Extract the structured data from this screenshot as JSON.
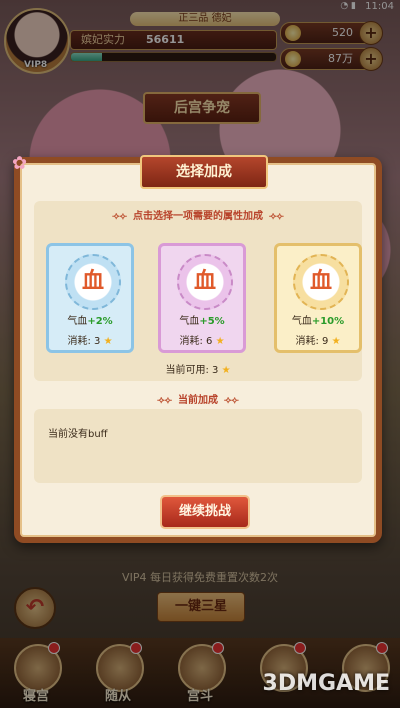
{
  "status_bar": {
    "time": "11:04",
    "signal": "WiFi"
  },
  "player": {
    "vip_label": "VIP8",
    "rank_text": "正三品 德妃",
    "power_label": "嫔妃实力",
    "power_value": "56611",
    "exp_progress": 0.15
  },
  "resources": [
    {
      "icon": "ingot-icon",
      "value": "520"
    },
    {
      "icon": "coin-icon",
      "value": "87万"
    }
  ],
  "scene_title": "后宫争宠",
  "dialog": {
    "title": "选择加成",
    "hint": "点击选择一项需要的属性加成",
    "cards": [
      {
        "emblem": "血",
        "attr_label": "气血",
        "attr_pct": "+2%",
        "cost_label": "消耗:",
        "cost_value": "3"
      },
      {
        "emblem": "血",
        "attr_label": "气血",
        "attr_pct": "+5%",
        "cost_label": "消耗:",
        "cost_value": "6"
      },
      {
        "emblem": "血",
        "attr_label": "气血",
        "attr_pct": "+10%",
        "cost_label": "消耗:",
        "cost_value": "9"
      }
    ],
    "available_label": "当前可用:",
    "available_value": "3",
    "buff_title": "当前加成",
    "buff_text": "当前没有buff",
    "continue_label": "继续挑战"
  },
  "vip_tip": "VIP4 每日获得免费重置次数2次",
  "oneclick_label": "一键三星",
  "nav": [
    {
      "label": "寝宫"
    },
    {
      "label": "随从"
    },
    {
      "label": "宫斗"
    },
    {
      "label": ""
    },
    {
      "label": ""
    }
  ],
  "watermark": "3DMGAME",
  "colors": {
    "accent_red": "#b8432b",
    "frame_brown": "#8f4b23",
    "bonus_green": "#2a9b2a"
  }
}
